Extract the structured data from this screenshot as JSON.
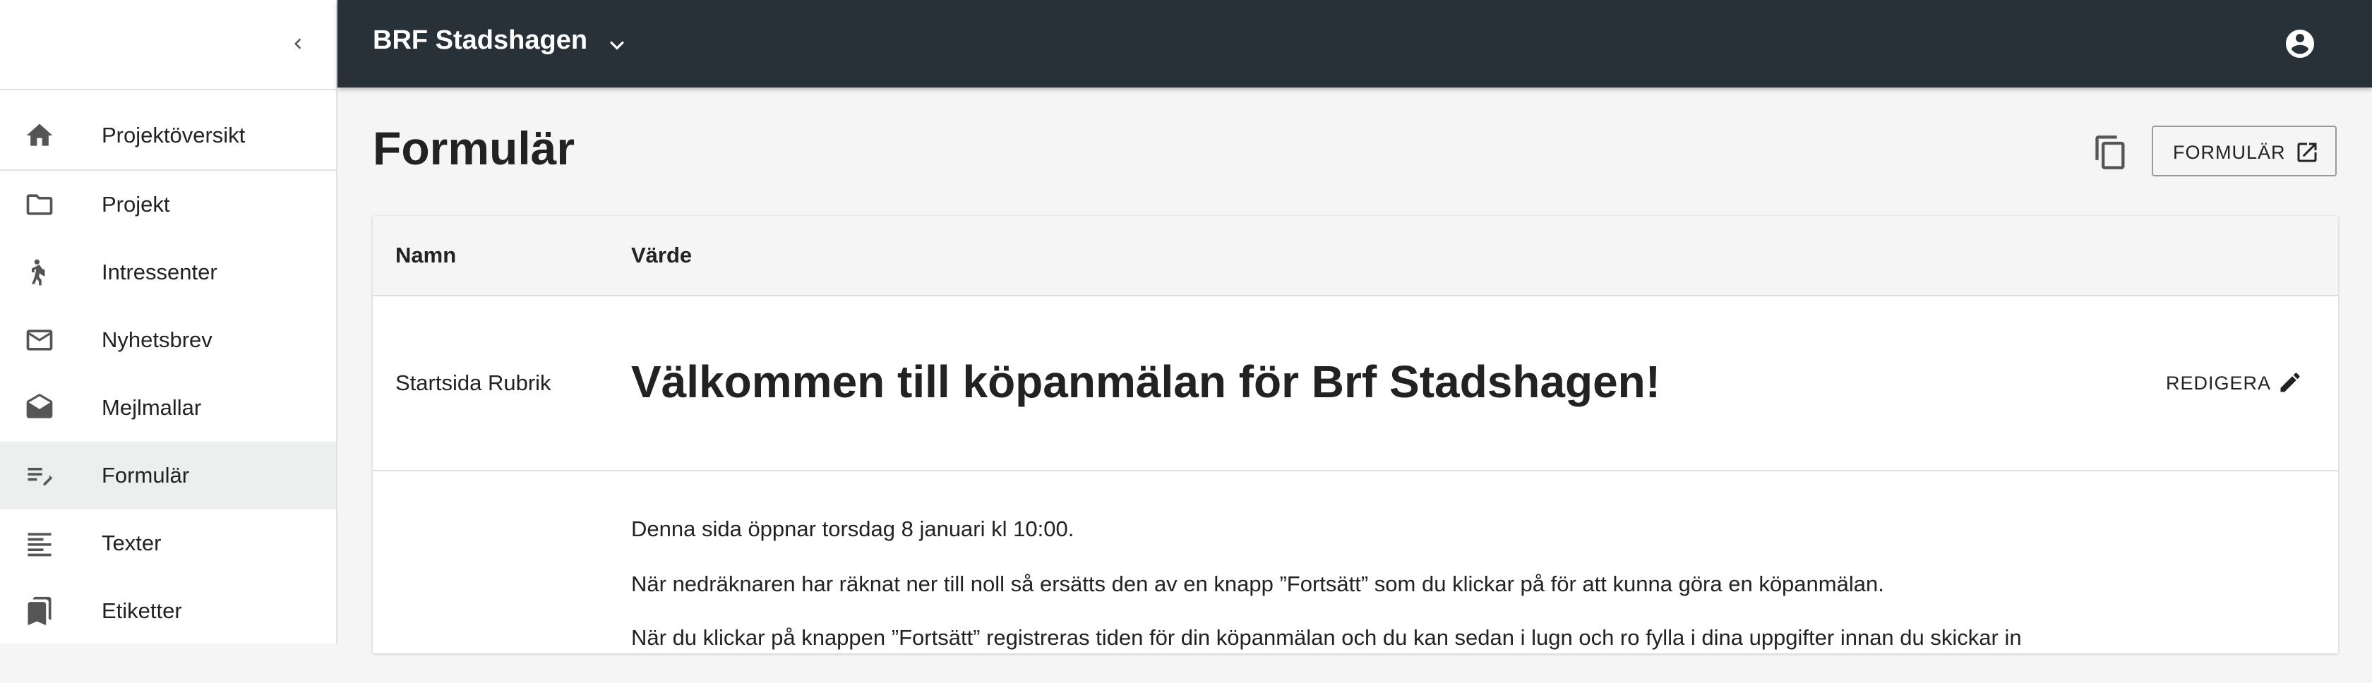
{
  "sidebar": {
    "items": [
      {
        "label": "Projektöversikt",
        "icon": "home-icon"
      },
      {
        "label": "Projekt",
        "icon": "folder-icon"
      },
      {
        "label": "Intressenter",
        "icon": "person-icon"
      },
      {
        "label": "Nyhetsbrev",
        "icon": "mail-icon"
      },
      {
        "label": "Mejlmallar",
        "icon": "open-mail-icon"
      },
      {
        "label": "Formulär",
        "icon": "edit-note-icon",
        "active": true
      },
      {
        "label": "Texter",
        "icon": "text-lines-icon"
      },
      {
        "label": "Etiketter",
        "icon": "bookmarks-icon"
      }
    ]
  },
  "topbar": {
    "project_name": "BRF Stadshagen"
  },
  "page": {
    "title": "Formulär",
    "form_button_label": "FORMULÄR"
  },
  "table": {
    "headers": {
      "name": "Namn",
      "value": "Värde"
    },
    "rows": [
      {
        "name": "Startsida Rubrik",
        "value": "Välkommen till köpanmälan för Brf Stadshagen!",
        "action": "REDIGERA"
      }
    ],
    "paragraphs": [
      "Denna sida öppnar torsdag 8 januari kl 10:00.",
      "När nedräknaren har räknat ner till noll så ersätts den av en knapp ”Fortsätt” som du klickar på för att kunna göra en köpanmälan.",
      "När du klickar på knappen ”Fortsätt” registreras tiden för din köpanmälan och du kan sedan i lugn och ro fylla i dina uppgifter innan du skickar in"
    ]
  },
  "colors": {
    "topbar": "#283038",
    "active_nav": "#ecefed",
    "background": "#f5f5f5"
  }
}
